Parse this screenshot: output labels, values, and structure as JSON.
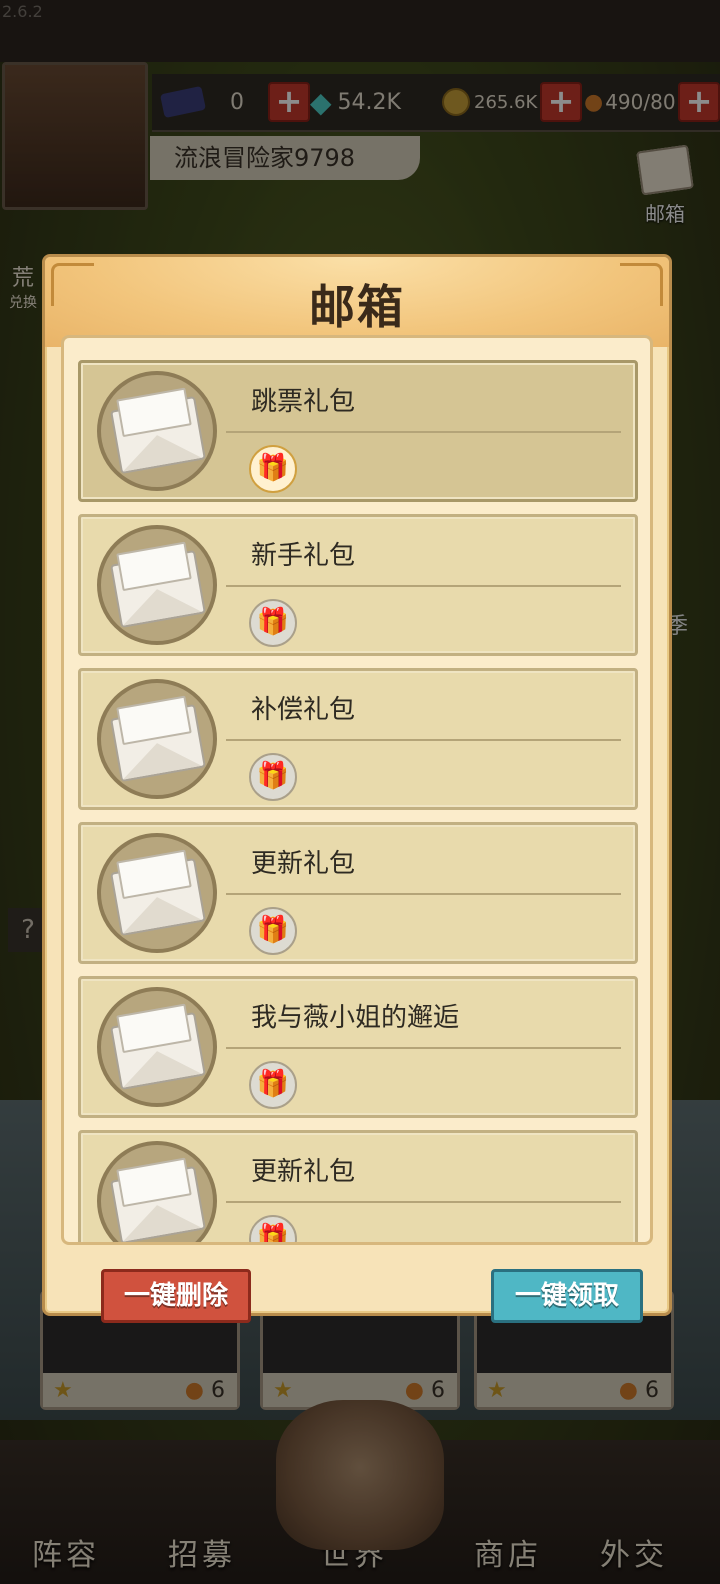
{
  "app": {
    "version": "2.6.2"
  },
  "player": {
    "name": "流浪冒险家9798"
  },
  "resources": {
    "crystal": "0",
    "diamonds": "54.2K",
    "gold": "265.6K",
    "food": "490/80"
  },
  "sidebar": {
    "mail_label": "邮箱",
    "left_label_1": "荒",
    "left_label_2": "兑换",
    "right_label": "季"
  },
  "help": {
    "label": "?"
  },
  "modal": {
    "title": "邮箱",
    "items": [
      {
        "title": "跳票礼包",
        "state": "unread",
        "gift": "🎁"
      },
      {
        "title": "新手礼包",
        "state": "read",
        "gift": "🎁"
      },
      {
        "title": "补偿礼包",
        "state": "read",
        "gift": "🎁"
      },
      {
        "title": "更新礼包",
        "state": "read",
        "gift": "🎁"
      },
      {
        "title": "我与薇小姐的邂逅",
        "state": "read",
        "gift": "🎁"
      },
      {
        "title": "更新礼包",
        "state": "read",
        "gift": "🎁"
      }
    ],
    "delete_all": "一键删除",
    "claim_all": "一键领取"
  },
  "cards": [
    {
      "cost": "6",
      "star": "★"
    },
    {
      "cost": "6",
      "star": "★"
    },
    {
      "cost": "6",
      "star": "★"
    }
  ],
  "bottom_nav": [
    "阵容",
    "招募",
    "世界",
    "商店",
    "外交"
  ],
  "colors": {
    "accent_red": "#d0523e",
    "accent_teal": "#4fb7c5",
    "panel": "#f7e3b8"
  }
}
